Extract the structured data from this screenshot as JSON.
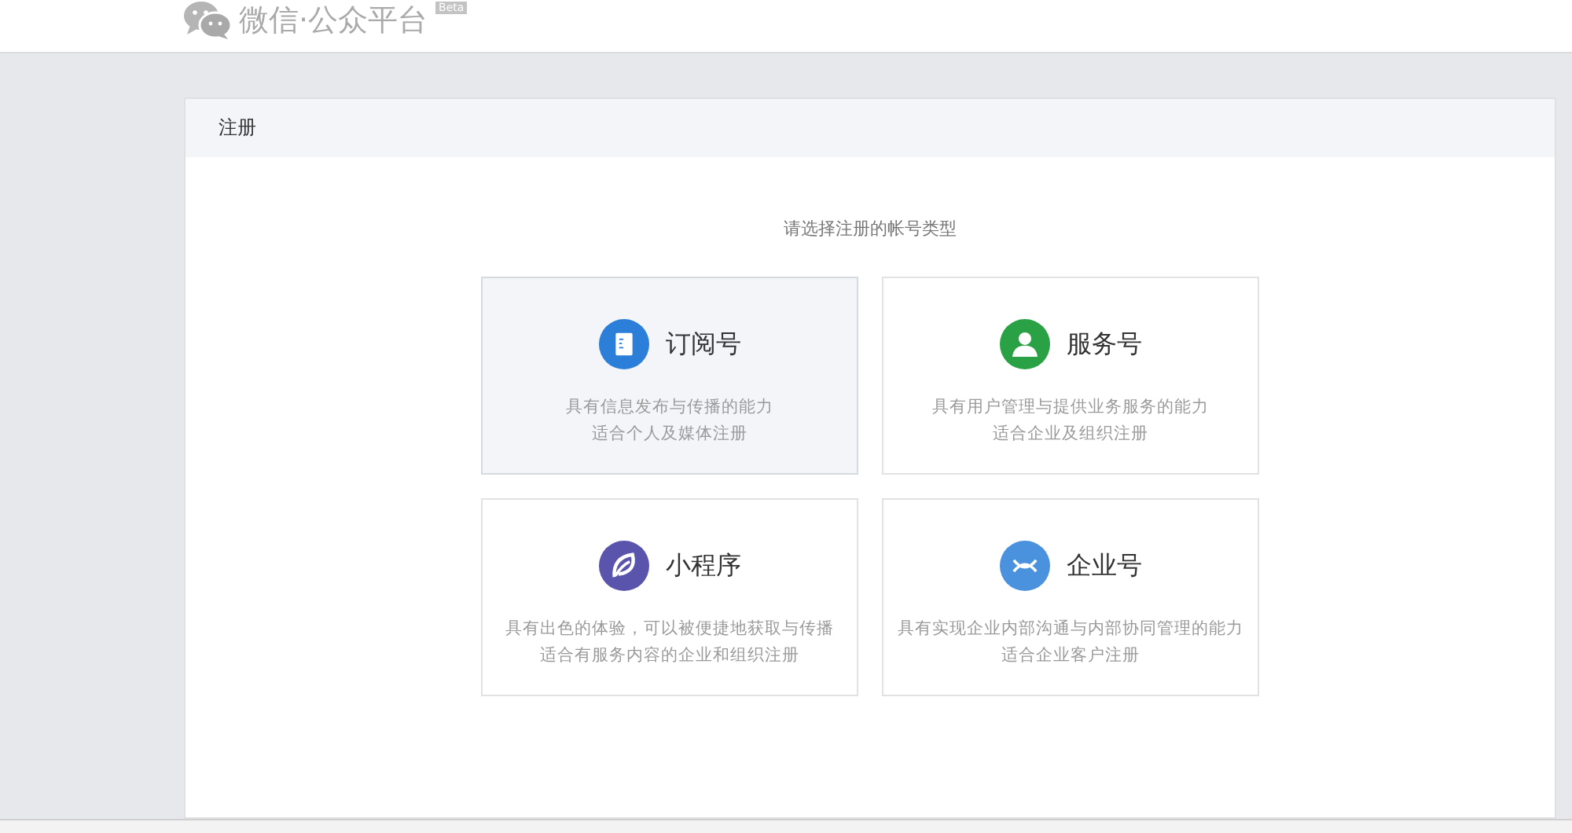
{
  "header": {
    "logo_text": "微信·公众平台",
    "badge": "Beta"
  },
  "panel": {
    "title": "注册",
    "prompt": "请选择注册的帐号类型",
    "account_types": [
      {
        "kind": "subscription",
        "name": "订阅号",
        "color": "#2b7fd9",
        "highlighted": true,
        "lines": [
          "具有信息发布与传播的能力",
          "适合个人及媒体注册"
        ]
      },
      {
        "kind": "service",
        "name": "服务号",
        "color": "#2aa144",
        "highlighted": false,
        "lines": [
          "具有用户管理与提供业务服务的能力",
          "适合企业及组织注册"
        ]
      },
      {
        "kind": "miniprogram",
        "name": "小程序",
        "color": "#5b54ad",
        "highlighted": false,
        "lines": [
          "具有出色的体验，可以被便捷地获取与传播",
          "适合有服务内容的企业和组织注册"
        ]
      },
      {
        "kind": "enterprise",
        "name": "企业号",
        "color": "#4b92de",
        "highlighted": false,
        "lines": [
          "具有实现企业内部沟通与内部协同管理的能力",
          "适合企业客户注册"
        ]
      }
    ]
  }
}
